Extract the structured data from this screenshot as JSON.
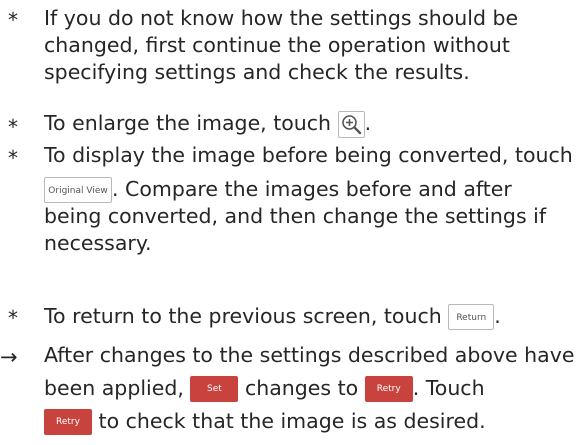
{
  "bullets": {
    "b1": {
      "marker": "*",
      "line1": "If you do not know how the settings should be",
      "line2": "changed, first continue the operation without",
      "line3": "specifying settings and check the results."
    },
    "b2": {
      "marker": "*",
      "before": "To enlarge the image, touch",
      "after": ".",
      "icon": "zoom-in-icon"
    },
    "b3": {
      "marker": "*",
      "line1": "To display the image before being converted, touch",
      "button": "Original View",
      "line2_after": ". Compare the images before and after",
      "line3": "being converted, and then change the settings if",
      "line4": "necessary."
    },
    "b4": {
      "marker": "*",
      "before": "To return to the previous screen, touch",
      "button": "Return",
      "after": "."
    },
    "b5": {
      "marker": "→",
      "line1": "After changes to the settings described above have",
      "line2_a": "been applied,",
      "set_button": "Set",
      "line2_b": "changes to",
      "retry_button": "Retry",
      "line2_c": ". Touch",
      "retry_button_2": "Retry",
      "line3": "to check that the image is as desired."
    }
  },
  "colors": {
    "text": "#262626",
    "red_button": "#c8433d",
    "button_border": "#b9b9b9"
  }
}
